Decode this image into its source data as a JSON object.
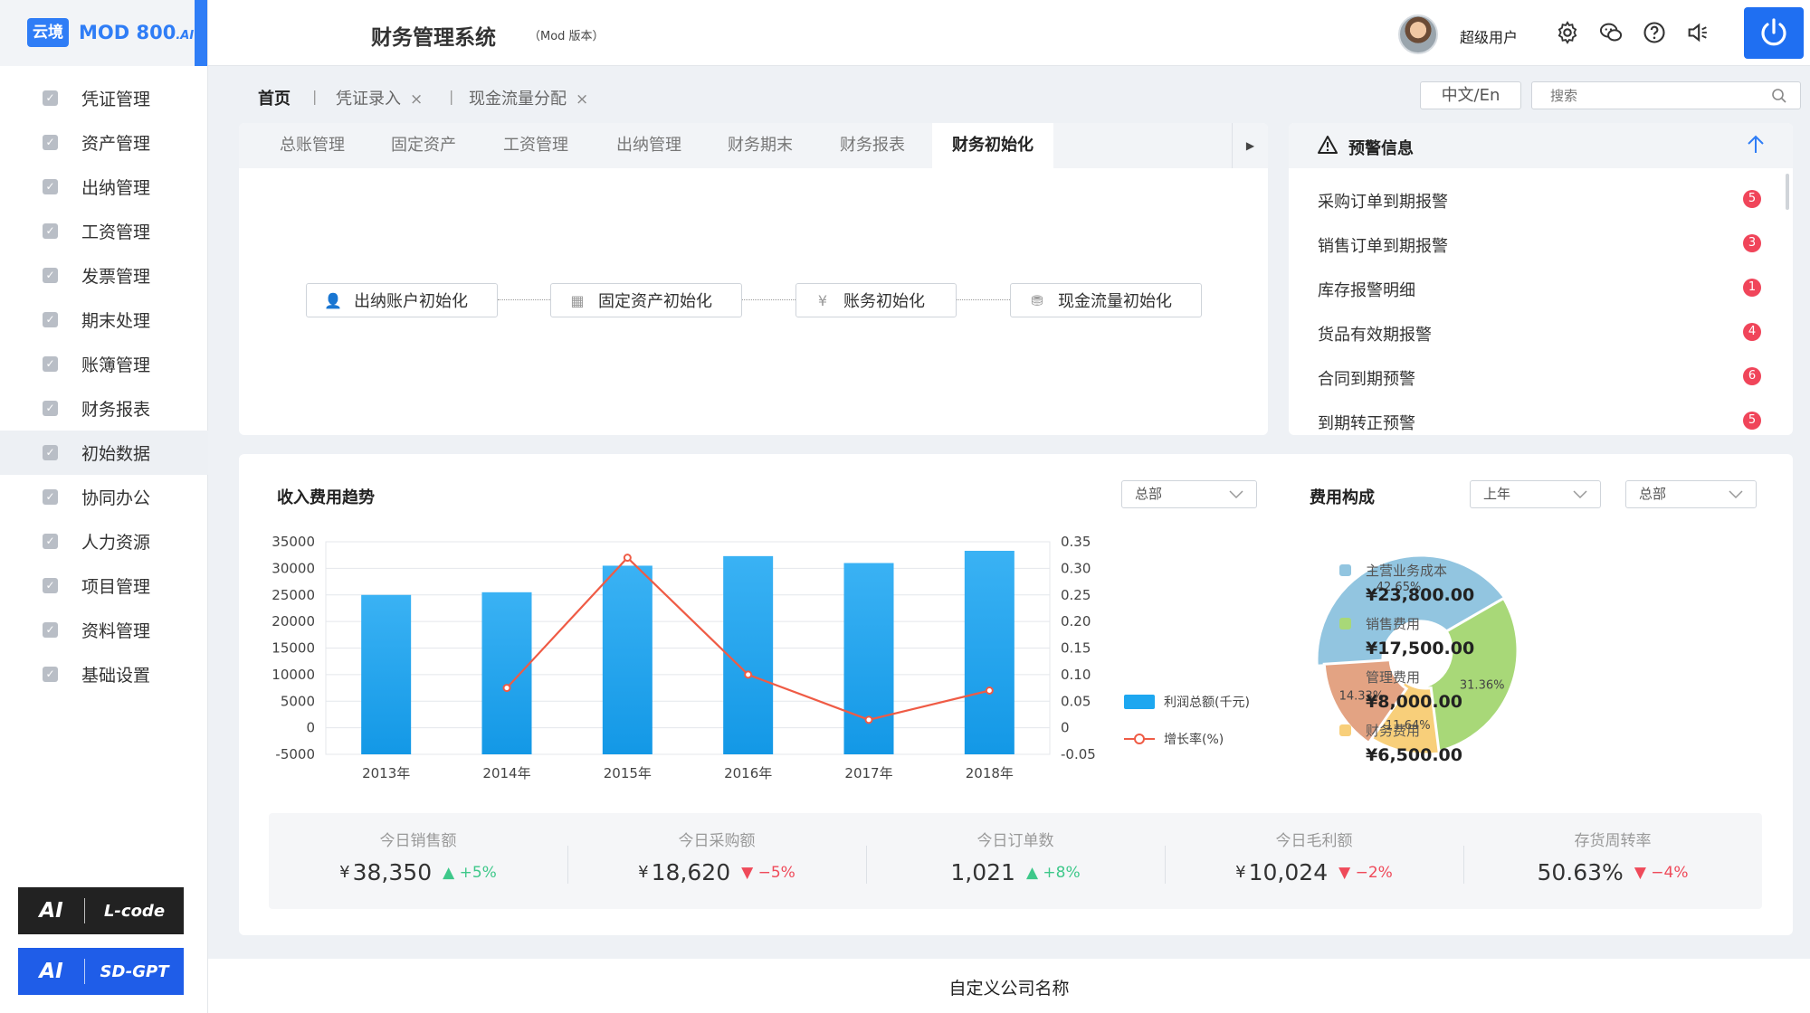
{
  "logo": {
    "box_text": "云境",
    "text": "MOD 800",
    "suffix": ".AI"
  },
  "sidebar": {
    "items": [
      {
        "label": "凭证管理"
      },
      {
        "label": "资产管理"
      },
      {
        "label": "出纳管理"
      },
      {
        "label": "工资管理"
      },
      {
        "label": "发票管理"
      },
      {
        "label": "期末处理"
      },
      {
        "label": "账簿管理"
      },
      {
        "label": "财务报表"
      },
      {
        "label": "初始数据",
        "active": true
      },
      {
        "label": "协同办公"
      },
      {
        "label": "人力资源"
      },
      {
        "label": "项目管理"
      },
      {
        "label": "资料管理"
      },
      {
        "label": "基础设置"
      }
    ],
    "ai_buttons": [
      {
        "ai": "AI",
        "label": "L-code"
      },
      {
        "ai": "AI",
        "label": "SD-GPT"
      }
    ]
  },
  "header": {
    "title": "财务管理系统",
    "subtitle": "（Mod 版本）",
    "username": "超级用户"
  },
  "tabs": {
    "home": "首页",
    "open": [
      "凭证录入",
      "现金流量分配"
    ],
    "close_glyph": "×",
    "separator": "|"
  },
  "toolbar": {
    "lang": "中文/En",
    "search_placeholder": "搜索"
  },
  "module_tabs": {
    "items": [
      "总账管理",
      "固定资产",
      "工资管理",
      "出纳管理",
      "财务期末",
      "财务报表",
      "财务初始化"
    ],
    "active_index": 6,
    "arrow": "▶"
  },
  "init_flow": [
    "出纳账户初始化",
    "固定资产初始化",
    "账务初始化",
    "现金流量初始化"
  ],
  "warnings": {
    "title": "预警信息",
    "items": [
      {
        "label": "采购订单到期报警",
        "count": "5"
      },
      {
        "label": "销售订单到期报警",
        "count": "3"
      },
      {
        "label": "库存报警明细",
        "count": "1"
      },
      {
        "label": "货品有效期报警",
        "count": "4"
      },
      {
        "label": "合同到期预警",
        "count": "6"
      },
      {
        "label": "到期转正预警",
        "count": "5"
      }
    ]
  },
  "trend": {
    "title": "收入费用趋势",
    "filter": "总部"
  },
  "cost": {
    "title": "费用构成",
    "filter_period": "上年",
    "filter_org": "总部"
  },
  "chart_data": [
    {
      "type": "bar",
      "categories": [
        "2013年",
        "2014年",
        "2015年",
        "2016年",
        "2017年",
        "2018年"
      ],
      "series": [
        {
          "name": "利润总额(千元)",
          "type": "bar",
          "axis": "left",
          "values": [
            25000,
            25500,
            30500,
            32300,
            31000,
            33300
          ]
        },
        {
          "name": "增长率(%)",
          "type": "line",
          "axis": "right",
          "values": [
            0.075,
            0.32,
            0.1,
            0.015,
            0.07
          ],
          "x": [
            "2014年",
            "2015年",
            "2016年",
            "2017年",
            "2018年"
          ]
        }
      ],
      "y_left": {
        "range": [
          -5000,
          35000
        ],
        "ticks": [
          "35000",
          "30000",
          "25000",
          "20000",
          "15000",
          "10000",
          "5000",
          "0",
          "-5000"
        ]
      },
      "y_right": {
        "range": [
          -0.05,
          0.35
        ],
        "ticks": [
          "0.35",
          "0.30",
          "0.25",
          "0.20",
          "0.15",
          "0.10",
          "0.05",
          "0",
          "-0.05"
        ]
      },
      "grid": true,
      "legend": "right",
      "colors": {
        "bar": "#1da7f0",
        "line": "#ef5b45"
      }
    },
    {
      "type": "pie",
      "donut": true,
      "slices": [
        {
          "name": "主营业务成本",
          "value": 23800,
          "value_label": "¥23,800.00",
          "percent_label": "42.65%",
          "color": "#92c5e0"
        },
        {
          "name": "销售费用",
          "value": 17500,
          "value_label": "¥17,500.00",
          "percent_label": "31.36%",
          "color": "#a8d878"
        },
        {
          "name": "管理费用",
          "value": 8000,
          "value_label": "¥8,000.00",
          "percent_label": "14.33%",
          "color": "#e3a383"
        },
        {
          "name": "财务费用",
          "value": 6500,
          "value_label": "¥6,500.00",
          "percent_label": "11.64%",
          "color": "#f8cf7a"
        }
      ],
      "legend": "right"
    }
  ],
  "kpis": [
    {
      "label": "今日销售额",
      "currency": "¥",
      "value": "38,350",
      "change": "+5%",
      "dir": "up"
    },
    {
      "label": "今日采购额",
      "currency": "¥",
      "value": "18,620",
      "change": "−5%",
      "dir": "down"
    },
    {
      "label": "今日订单数",
      "currency": "",
      "value": "1,021",
      "change": "+8%",
      "dir": "up"
    },
    {
      "label": "今日毛利额",
      "currency": "¥",
      "value": "10,024",
      "change": "−2%",
      "dir": "down"
    },
    {
      "label": "存货周转率",
      "currency": "",
      "value": "50.63%",
      "change": "−4%",
      "dir": "down"
    }
  ],
  "footer": {
    "company": "自定义公司名称"
  },
  "colors": {
    "accent": "#2f7df6",
    "power": "#1f6ff2",
    "badge": "#f0455a",
    "up": "#3ec88a",
    "down": "#ef4a5a"
  }
}
